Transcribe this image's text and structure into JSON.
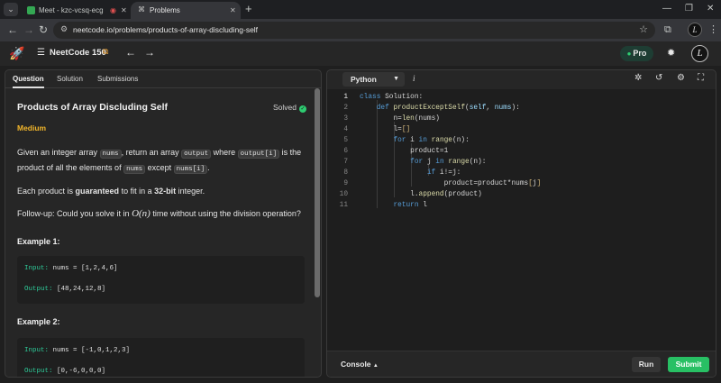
{
  "browser": {
    "tabs": [
      {
        "title": "Meet - kzc-vcsq-ecg",
        "active": false
      },
      {
        "title": "Problems",
        "active": true
      }
    ],
    "url": "neetcode.io/problems/products-of-array-discluding-self",
    "new_tab_symbol": "+"
  },
  "header": {
    "list_title": "NeetCode 150",
    "pro_label": "Pro",
    "avatar_letter": "L"
  },
  "left_panel": {
    "tabs": [
      "Question",
      "Solution",
      "Submissions"
    ],
    "title": "Products of Array Discluding Self",
    "status": "Solved",
    "difficulty": "Medium",
    "description": {
      "p1_a": "Given an integer array ",
      "p1_code1": "nums",
      "p1_b": ", return an array ",
      "p1_code2": "output",
      "p1_c": " where ",
      "p1_code3": "output[i]",
      "p1_d": " is the product of all the elements of ",
      "p1_code4": "nums",
      "p1_e": " except ",
      "p1_code5": "nums[i]",
      "p1_f": ".",
      "p2_a": "Each product is ",
      "p2_bold1": "guaranteed",
      "p2_b": " to fit in a ",
      "p2_bold2": "32-bit",
      "p2_c": " integer.",
      "p3_a": "Follow-up: Could you solve it in ",
      "p3_math": "O(n)",
      "p3_b": " time without using the division operation?"
    },
    "examples": [
      {
        "heading": "Example 1:",
        "input_label": "Input:",
        "input_value": " nums = [1,2,4,6]",
        "output_label": "Output:",
        "output_value": " [48,24,12,8]"
      },
      {
        "heading": "Example 2:",
        "input_label": "Input:",
        "input_value": " nums = [-1,0,1,2,3]",
        "output_label": "Output:",
        "output_value": " [0,-6,0,0,0]"
      }
    ]
  },
  "editor": {
    "language": "Python",
    "info_symbol": "i",
    "code_lines": [
      "class Solution:",
      "    def productExceptSelf(self, nums):",
      "        n=len(nums)",
      "        l=[]",
      "        for i in range(n):",
      "            product=1",
      "            for j in range(n):",
      "                if i!=j:",
      "                    product=product*nums[j]",
      "            l.append(product)",
      "        return l"
    ],
    "console_label": "Console",
    "run_label": "Run",
    "submit_label": "Submit"
  },
  "colors": {
    "accent_green": "#28c064",
    "difficulty_medium": "#f2b62b",
    "keyword_blue": "#569cd6",
    "function_yellow": "#dcdcaa"
  }
}
